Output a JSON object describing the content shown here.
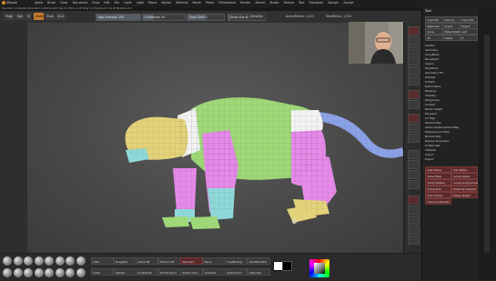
{
  "app": {
    "title": "ZBrush",
    "menus": [
      "Alpha",
      "Brush",
      "Color",
      "Document",
      "Draw",
      "Edit",
      "File",
      "Layer",
      "Light",
      "Macro",
      "Marker",
      "Material",
      "Movie",
      "Picker",
      "Preferences",
      "Render",
      "Stencil",
      "Stroke",
      "Texture",
      "Tool",
      "Transform",
      "Zplugin",
      "Zscript"
    ],
    "subbar_text": "Free Mem 14.962GB  Active Mem 1.004  Scratch Disk 41  ZTime 1.28  Timer 0.1  PolyCount 5.49 KP  MeshCount 1"
  },
  "toolbar": {
    "mrgb_label": "Mrgb",
    "rgb_label": "Rgb",
    "m_label": "M",
    "zadd_label": "Zadd",
    "zsub_label": "Zsub",
    "zcut_label": "Zcut",
    "focal_shift_label": "Focal Shift 0",
    "draw_size_label": "Draw Size 64",
    "rgb_intensity_label": "Rgb Intensity 100",
    "z_intensity_label": "Z Intensity 25",
    "dynamic_label": "Dynamic",
    "active_points_label": "ActivePoints: 1,220",
    "total_points_label": "TotalPoints: 1,220",
    "symmetry_label": "Symmetry"
  },
  "tray": {
    "header": "Tool",
    "items_top": [
      "SubTool",
      "Geometry",
      "ArrayMesh",
      "NanoMesh",
      "Layers",
      "FiberMesh",
      "Geometry HD",
      "Preview",
      "Surface",
      "Deformation",
      "Masking",
      "Visibility",
      "Polygroups",
      "Contact",
      "Morph Target",
      "Polypaint",
      "UV Map",
      "Texture Map",
      "Vector Displacement Map",
      "Displacement Map",
      "Normal Map",
      "Display Properties",
      "Unified Skin",
      "Initialize",
      "Import",
      "Export"
    ],
    "red_buttons": [
      "Lazy Mouse",
      "Del Hidden",
      "Close Holes",
      "Group Visible",
      "Group Masked",
      "Group As Dynamesh Sub",
      "Group Split",
      "Polish By Features",
      "Auto Groups",
      "Merge Similar",
      "Group by Normals"
    ],
    "dark_buttons": [
      "Load Tool",
      "Save As",
      "Copy Tool",
      "Paste Tool",
      "Import",
      "Export",
      "Clone",
      "Make PolyMesh3D",
      "GoZ",
      "All",
      "Visible",
      "R"
    ]
  },
  "bottom": {
    "brush_count": 16,
    "buttons": [
      "Dots",
      "DragRect",
      "Alpha Off",
      "Texture Off",
      "Standard",
      "Move",
      "ClayBuildup",
      "DamStandard",
      "Inflat",
      "hPolish",
      "SnakeHook",
      "TrimDynamic",
      "Switch Color",
      "Gradient",
      "SwitchColor",
      "Alternate"
    ]
  },
  "colors": {
    "accent_red": "#7a2a2a",
    "viewport_bg": "#484848",
    "model_yellow": "#e3d27a",
    "model_green": "#9fd878",
    "model_magenta": "#e58ae8",
    "model_white": "#f2f2f2",
    "model_cyan": "#8fd8d8",
    "model_blue": "#8ca2e6"
  }
}
